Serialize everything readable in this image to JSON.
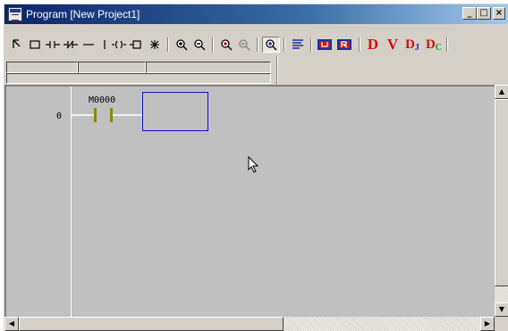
{
  "window": {
    "title": "Program  [New Project1]",
    "controls": {
      "minimize": "_",
      "maximize": "□",
      "close": "×"
    }
  },
  "toolbar": {
    "groups": [
      [
        "select-arrow-icon",
        "rectangle-select-icon",
        "contact-no-icon",
        "contact-nc-icon",
        "horizontal-line-icon",
        "vertical-line-icon",
        "coil-icon",
        "function-block-icon",
        "star-icon"
      ],
      [
        "zoom-in-icon",
        "zoom-out-icon"
      ],
      [
        "zoom-in-red-icon",
        "zoom-out-disabled-icon"
      ],
      [
        "zoom-fit-pressed-icon"
      ],
      [
        "align-lines-icon"
      ],
      [
        "monitor-u-icon",
        "monitor-r-icon"
      ],
      [
        "device-d-icon",
        "device-v-icon",
        "device-dj-icon",
        "device-dc-icon"
      ]
    ],
    "letters": {
      "d": "D",
      "v": "V",
      "dj": "D",
      "dj_sub": "J",
      "dc": "D",
      "dc_sub": "C"
    },
    "colors": {
      "red": "#d01010",
      "blue": "#1c2ca8",
      "green": "#18a018"
    }
  },
  "editor": {
    "rung_number": "0",
    "device_label": "M0000",
    "colors": {
      "background": "#c0c0c0",
      "contact": "#8a8a10",
      "cursor": "#1010c8"
    }
  }
}
